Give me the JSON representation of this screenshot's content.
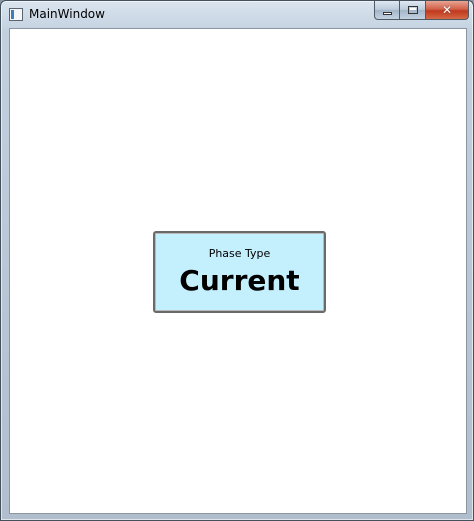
{
  "window": {
    "title": "MainWindow",
    "icon": "app-window-icon",
    "controls": {
      "minimize": "minimize-icon",
      "maximize": "maximize-icon",
      "close": "close-icon",
      "close_glyph": "✕"
    }
  },
  "phase_card": {
    "label": "Phase Type",
    "value": "Current",
    "background": "#c4f0fe"
  }
}
